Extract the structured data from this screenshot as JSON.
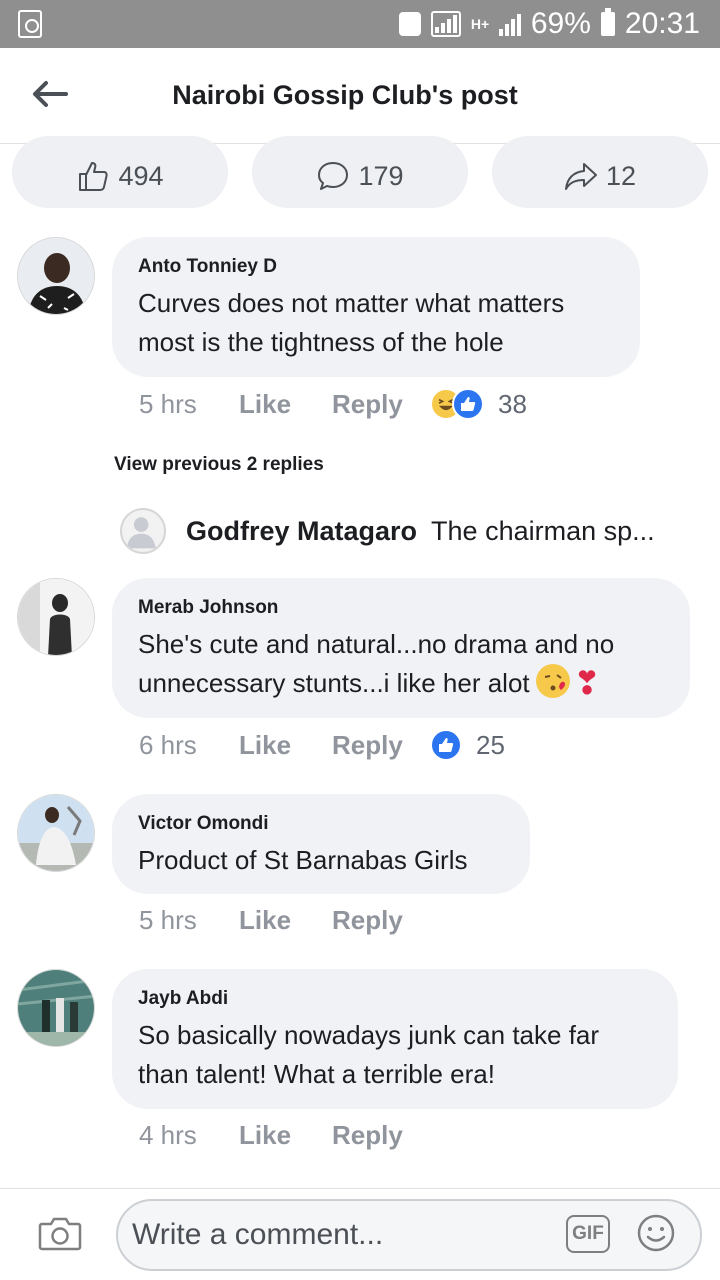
{
  "status_bar": {
    "hspa": "H+",
    "battery": "69%",
    "time": "20:31"
  },
  "header": {
    "title": "Nairobi Gossip Club's post",
    "back_icon": "back-arrow-icon"
  },
  "reactions_bar": {
    "likes": "494",
    "comments": "179",
    "shares": "12"
  },
  "comments": [
    {
      "author": "Anto Tonniey D",
      "text": "Curves does not matter what matters most is the tightness of the hole",
      "time": "5 hrs",
      "like_label": "Like",
      "reply_label": "Reply",
      "reaction_count": "38",
      "reaction_icons": [
        "laugh-emoji-icon",
        "like-reaction-icon"
      ]
    },
    {
      "author": "Merab Johnson",
      "text": "She's cute and natural...no drama and no unnecessary stunts...i like her alot",
      "time": "6 hrs",
      "like_label": "Like",
      "reply_label": "Reply",
      "reaction_count": "25",
      "reaction_icons": [
        "like-reaction-icon"
      ]
    },
    {
      "author": "Victor Omondi",
      "text": "Product of St Barnabas Girls",
      "time": "5 hrs",
      "like_label": "Like",
      "reply_label": "Reply"
    },
    {
      "author": "Jayb Abdi",
      "text": "So basically nowadays junk can take far than talent! What a terrible era!",
      "time": "4 hrs",
      "like_label": "Like",
      "reply_label": "Reply"
    }
  ],
  "view_previous_replies": "View previous 2 replies",
  "reply_preview": {
    "author": "Godfrey Matagaro",
    "text": "The chairman sp..."
  },
  "composer": {
    "placeholder": "Write a comment...",
    "gif_label": "GIF"
  },
  "colors": {
    "status_bar": "#8f8f8f",
    "bubble": "#f0f2f5",
    "like_blue": "#2b75f0",
    "meta_gray": "#90949c"
  }
}
